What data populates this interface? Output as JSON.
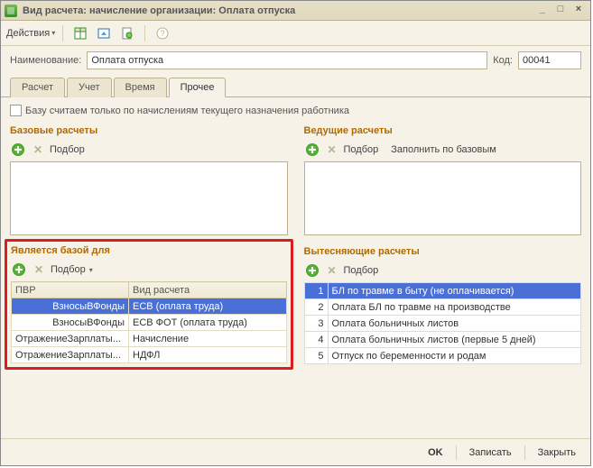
{
  "window": {
    "title": "Вид расчета: начисление организации: Оплата отпуска",
    "minimize": "_",
    "maximize": "□",
    "close": "×"
  },
  "toolbar": {
    "actions": "Действия"
  },
  "form": {
    "name_label": "Наименование:",
    "name_value": "Оплата отпуска",
    "code_label": "Код:",
    "code_value": "00041"
  },
  "tabs": [
    "Расчет",
    "Учет",
    "Время",
    "Прочее"
  ],
  "active_tab": 3,
  "checkbox_label": "Базу считаем только по начислениям текущего назначения работника",
  "panels": {
    "base": {
      "title": "Базовые расчеты",
      "select": "Подбор"
    },
    "leading": {
      "title": "Ведущие расчеты",
      "select": "Подбор",
      "fill": "Заполнить по базовым"
    },
    "is_base_for": {
      "title": "Является базой для",
      "select": "Подбор",
      "columns": [
        "ПВР",
        "Вид расчета"
      ],
      "rows": [
        {
          "pvr": "ВзносыВФонды",
          "kind": "ЕСВ (оплата труда)",
          "selected": true,
          "hl": true
        },
        {
          "pvr": "ВзносыВФонды",
          "kind": "ЕСВ ФОТ (оплата труда)",
          "hl": true
        },
        {
          "pvr": "ОтражениеЗарплаты...",
          "kind": "Начисление"
        },
        {
          "pvr": "ОтражениеЗарплаты...",
          "kind": "НДФЛ"
        }
      ]
    },
    "displacing": {
      "title": "Вытесняющие расчеты",
      "select": "Подбор",
      "column": "№",
      "rows": [
        "БЛ по травме в быту (не оплачивается)",
        "Оплата БЛ по травме на производстве",
        "Оплата больничных листов",
        "Оплата больничных листов (первые 5 дней)",
        "Отпуск по беременности и родам"
      ]
    }
  },
  "footer": {
    "ok": "OK",
    "save": "Записать",
    "close": "Закрыть"
  }
}
